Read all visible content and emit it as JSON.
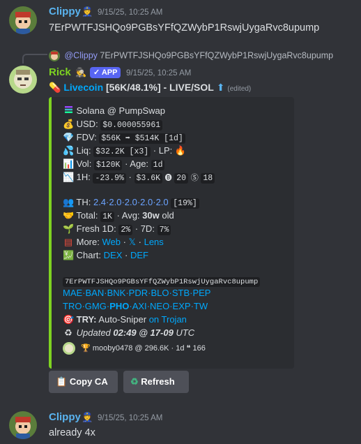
{
  "messages": [
    {
      "author": "Clippy",
      "author_badge_icon": "police-officer-icon",
      "timestamp": "9/15/25, 10:25 AM",
      "text": "7ErPWTFJSHQo9PGBsYFfQZWybP1RswjUygaRvc8upump"
    },
    {
      "reply": {
        "author": "@Clippy",
        "text": "7ErPWTFJSHQo9PGBsYFfQZWybP1RswjUygaRvc8upump"
      },
      "author": "Rick",
      "author_badge_icon": "detective-icon",
      "app_tag": "✓ APP",
      "timestamp": "9/15/25, 10:25 AM",
      "title": {
        "emoji": "💊",
        "coin": "Livecoin",
        "rest": "[56K/48.1%] - LIVE/SOL",
        "arrow": "⬆",
        "edited": "(edited)"
      },
      "embed": {
        "accent_color": "#7ed321",
        "header": "Solana @ PumpSwap",
        "usd_label": "USD:",
        "usd_value": "$0.000055961",
        "fdv_label": "FDV:",
        "fdv_from": "$56K",
        "fdv_arrow": "➡",
        "fdv_to": "$514K",
        "fdv_period": "[1d]",
        "liq_label": "Liq:",
        "liq_value": "$32.2K",
        "liq_mult": "[x3]",
        "lp_label": "· LP:",
        "vol_label": "Vol:",
        "vol_value": "$120K",
        "age_label": "· Age:",
        "age_value": "1d",
        "h1_label": "1H:",
        "h1_change": "-23.9%",
        "h1_dot": "·",
        "h1_vol": "$3.6K",
        "h1_buys": "20",
        "h1_sells": "18",
        "th_label": "TH:",
        "th_values": "2.4·2.0·2.0·2.0·2.0",
        "th_total": "[19%]",
        "total_label": "Total:",
        "total_value": "1K",
        "avg_label": "· Avg:",
        "avg_value": "30w",
        "avg_suffix": "old",
        "fresh_label": "Fresh 1D:",
        "fresh_1d": "2%",
        "fresh_7d_label": "· 7D:",
        "fresh_7d": "7%",
        "more_label": "More:",
        "more_web": "Web",
        "more_x": "𝕏",
        "more_lens": "Lens",
        "chart_label": "Chart:",
        "chart_dex": "DEX",
        "chart_def": "DEF",
        "contract": "7ErPWTFJSHQo9PGBsYFfQZWybP1RswjUygaRvc8upump",
        "links_row1": [
          "MAE",
          "BAN",
          "BNK",
          "PDR",
          "BLO",
          "STB",
          "PEP"
        ],
        "links_row2": [
          "TRO",
          "GMG",
          "PHO",
          "AXI",
          "NEO",
          "EXP",
          "TW"
        ],
        "try_label": "TRY:",
        "try_text": "Auto-Sniper",
        "try_link": "on Trojan",
        "updated_label": "Updated",
        "updated_time": "02:49 @ 17-09",
        "updated_tz": "UTC",
        "footer_user": "mooby0478 @ 296.6K · 1d",
        "footer_quotes": "166"
      },
      "buttons": [
        {
          "label": "Copy CA",
          "icon": "clipboard-icon"
        },
        {
          "label": "Refresh",
          "icon": "recycle-icon"
        }
      ]
    },
    {
      "author": "Clippy",
      "author_badge_icon": "police-officer-icon",
      "timestamp": "9/15/25, 10:25 AM",
      "text": "already 4x"
    }
  ],
  "colors": {
    "background": "#313338",
    "clippy_name": "#5ab4f0",
    "rick_name": "#7ed321",
    "link": "#00a8fc",
    "app_tag": "#5865f2"
  }
}
